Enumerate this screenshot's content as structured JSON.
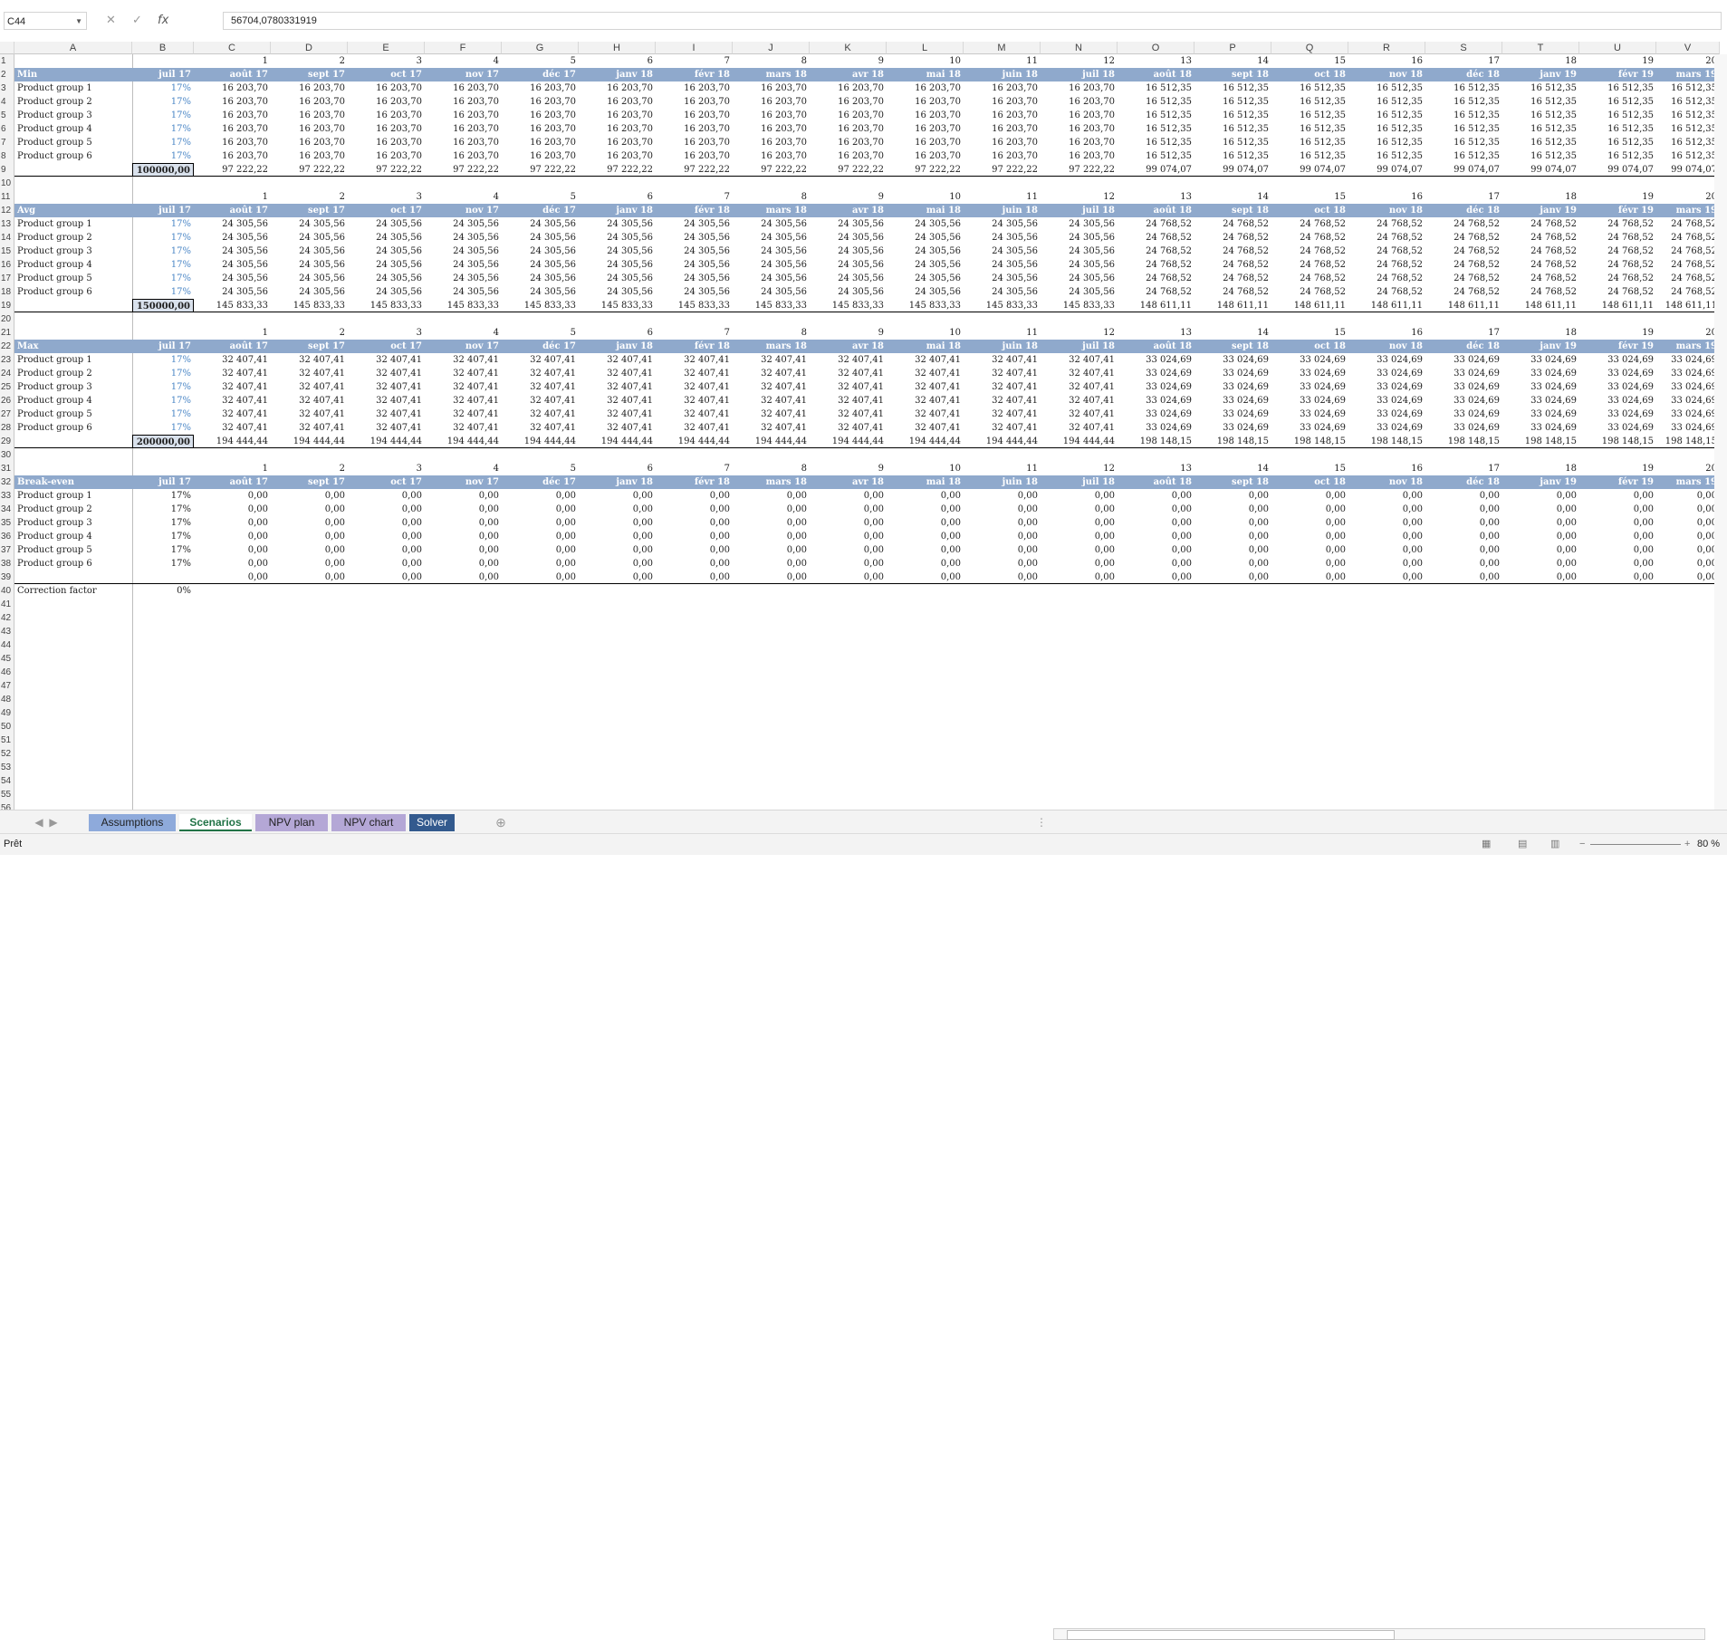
{
  "namebox": "C44",
  "formula": "56704,0780331919",
  "columns": [
    "A",
    "B",
    "C",
    "D",
    "E",
    "F",
    "G",
    "H",
    "I",
    "J",
    "K",
    "L",
    "M",
    "N",
    "O",
    "P",
    "Q",
    "R",
    "S",
    "T",
    "U",
    "V"
  ],
  "months": [
    "juil 17",
    "août 17",
    "sept 17",
    "oct 17",
    "nov 17",
    "déc 17",
    "janv 18",
    "févr 18",
    "mars 18",
    "avr 18",
    "mai 18",
    "juin 18",
    "juil 18",
    "août 18",
    "sept 18",
    "oct 18",
    "nov 18",
    "déc 18",
    "janv 19",
    "févr 19",
    "mars 19"
  ],
  "index_numbers": [
    "1",
    "2",
    "3",
    "4",
    "5",
    "6",
    "7",
    "8",
    "9",
    "10",
    "11",
    "12",
    "13",
    "14",
    "15",
    "16",
    "17",
    "18",
    "19",
    "20"
  ],
  "products": [
    "Product group 1",
    "Product group 2",
    "Product group 3",
    "Product group 4",
    "Product group 5",
    "Product group 6"
  ],
  "pct": "17%",
  "sections": [
    {
      "title": "Min",
      "boxed": "100000,00",
      "v1": "16 203,70",
      "v2": "16 512,35",
      "t1": "97 222,22",
      "t2": "99 074,07",
      "light": true
    },
    {
      "title": "Avg",
      "boxed": "150000,00",
      "v1": "24 305,56",
      "v2": "24 768,52",
      "t1": "145 833,33",
      "t2": "148 611,11",
      "light": true
    },
    {
      "title": "Max",
      "boxed": "200000,00",
      "v1": "32 407,41",
      "v2": "33 024,69",
      "t1": "194 444,44",
      "t2": "198 148,15",
      "light": true
    },
    {
      "title": "Break-even",
      "boxed": "",
      "v1": "0,00",
      "v2": "0,00",
      "t1": "0,00",
      "t2": "0,00",
      "light": false
    }
  ],
  "correction_label": "Correction factor",
  "correction_value": "0%",
  "tabs": [
    {
      "label": "Assumptions",
      "bg": "#8eaadb",
      "fg": "#1f1f1f"
    },
    {
      "label": "Scenarios",
      "bg": "#ffffff",
      "fg": "#217346"
    },
    {
      "label": "NPV plan",
      "bg": "#b4a7d6",
      "fg": "#1f1f1f"
    },
    {
      "label": "NPV chart",
      "bg": "#b4a7d6",
      "fg": "#1f1f1f"
    },
    {
      "label": "Solver",
      "bg": "#335a8e",
      "fg": "#ffffff"
    }
  ],
  "status_text": "Prêt",
  "zoom": "80 %"
}
